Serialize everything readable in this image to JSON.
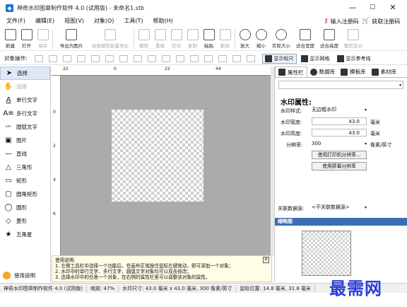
{
  "window": {
    "title": "神奇水印图章制作软件 4.0 (试用版) - 未命名1.stb",
    "minimize": "—",
    "maximize": "☐",
    "close": "✕"
  },
  "menu": {
    "items": [
      "文件(F)",
      "编辑(E)",
      "视图(V)",
      "对象(O)",
      "工具(T)",
      "帮助(H)"
    ],
    "register": "输入注册码",
    "buy": "获取注册码"
  },
  "toolbar": {
    "buttons": [
      "新建",
      "打开",
      "保存",
      "导出为图片",
      "依数据库批量导出",
      "撤销",
      "重做",
      "剪切",
      "复制",
      "粘贴",
      "删除",
      "放大",
      "缩小",
      "实际大小",
      "适合宽度",
      "适合高度",
      "整页显示"
    ]
  },
  "opsbar": {
    "label": "对象操作:",
    "show_ruler": "显示标尺",
    "show_grid": "显示网格",
    "show_guides": "显示参考线"
  },
  "tools": {
    "select": "选择",
    "stamp": "选择",
    "single_text": "单行文字",
    "multi_text": "多行文字",
    "arc_text": "圆弧文字",
    "image": "图片",
    "line": "直线",
    "triangle": "三角形",
    "rect": "矩形",
    "rounded_rect": "圆角矩形",
    "ellipse": "圆形",
    "diamond": "菱形",
    "star": "五角星",
    "help": "使用说明"
  },
  "ruler": {
    "labels": [
      "22",
      "0",
      "22",
      "44"
    ],
    "vlabels": [
      "0",
      "2",
      "4",
      "6"
    ]
  },
  "help_panel": {
    "title": "使用说明:",
    "line1": "1. 左侧工具栏中选择一个功能后，在画布区域按住鼠标左键拖动，即可添加一个对象；",
    "line2": "2. 水印中的单行文字、多行文字，圆弧文字对象均可以双击修改；",
    "line3": "3. 选择水印中的任意一个对象，在右侧的属性栏里可以调整该对象的属性。",
    "close": "✕"
  },
  "right_panel": {
    "tabs": [
      "属性栏",
      "数据库",
      "模板库",
      "素材库"
    ],
    "dropdown_arrow": "▾",
    "title": "水印属性:",
    "style_label": "水印样式:",
    "style_value": "无边框水印",
    "width_label": "水印宽度:",
    "width_value": "43.0",
    "width_unit": "毫米",
    "height_label": "水印高度:",
    "height_value": "43.0",
    "height_unit": "毫米",
    "dpi_label": "分辨率:",
    "dpi_value": "300",
    "dpi_unit": "像素/英寸",
    "btn_print_dpi": "使用打印机分辨率...",
    "btn_screen_dpi": "使用屏幕分辨率",
    "db_label": "关联数据源:",
    "db_value": "<不关联数据源>",
    "preview": "缩略图"
  },
  "status": {
    "app": "神奇水印图章制作软件 4.0 (试用版)",
    "zoom": "缩放: 47%",
    "size": "水印尺寸: 43.0 毫米 x 43.0 毫米, 300 像素/英寸",
    "mouse": "鼠标位置: 14.8 毫米, 31.8 毫米"
  },
  "watermark_text": "最需网"
}
